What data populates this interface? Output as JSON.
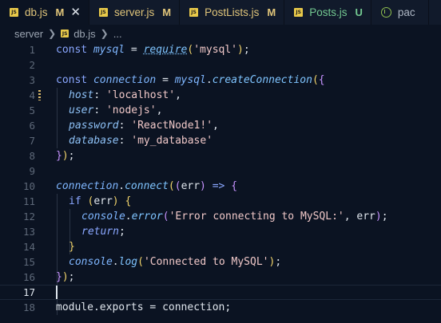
{
  "tabs": [
    {
      "label": "db.js",
      "badge": "M",
      "active": true,
      "icon": "js-icon"
    },
    {
      "label": "server.js",
      "badge": "M",
      "active": false,
      "icon": "js-icon"
    },
    {
      "label": "PostLists.js",
      "badge": "M",
      "active": false,
      "icon": "js-icon"
    },
    {
      "label": "Posts.js",
      "badge": "U",
      "active": false,
      "icon": "js-icon"
    },
    {
      "label": "pac",
      "badge": "",
      "active": false,
      "icon": "package-icon"
    }
  ],
  "breadcrumb": {
    "folder": "server",
    "file": "db.js",
    "more": "..."
  },
  "editor": {
    "current_line": 17,
    "line_numbers": [
      "1",
      "2",
      "3",
      "4",
      "5",
      "6",
      "7",
      "8",
      "9",
      "10",
      "11",
      "12",
      "13",
      "14",
      "15",
      "16",
      "17",
      "18"
    ],
    "lines": {
      "l1": {
        "kw": "const",
        "sp1": " ",
        "var": "mysql",
        "eq": " = ",
        "req": "require",
        "p1": "(",
        "str": "'mysql'",
        "p2": ")",
        "end": ";"
      },
      "l3": {
        "kw": "const",
        "sp1": " ",
        "var": "connection",
        "eq": " = ",
        "obj": "mysql",
        "dot": ".",
        "fn": "createConnection",
        "p1": "(",
        "br": "{"
      },
      "l4": {
        "prop": "host",
        "colon": ": ",
        "str": "'localhost'",
        "comma": ","
      },
      "l5": {
        "prop": "user",
        "colon": ": ",
        "str": "'nodejs'",
        "comma": ","
      },
      "l6": {
        "prop": "password",
        "colon": ": ",
        "str": "'ReactNode1!'",
        "comma": ","
      },
      "l7": {
        "prop": "database",
        "colon": ": ",
        "str": "'my_database'"
      },
      "l8": {
        "br": "}",
        "p2": ")",
        "end": ";"
      },
      "l10": {
        "obj": "connection",
        "dot": ".",
        "fn": "connect",
        "p1": "(",
        "p2": "(",
        "arg": "err",
        "p3": ")",
        "arrow": " => ",
        "br": "{"
      },
      "l11": {
        "kw": "if",
        "sp": " ",
        "p1": "(",
        "arg": "err",
        "p2": ")",
        "sp2": " ",
        "br": "{"
      },
      "l12": {
        "obj": "console",
        "dot": ".",
        "fn": "error",
        "p1": "(",
        "str": "'Error connecting to MySQL:'",
        "comma": ", ",
        "arg": "err",
        "p2": ")",
        "end": ";"
      },
      "l13": {
        "kw": "return",
        "end": ";"
      },
      "l14": {
        "br": "}"
      },
      "l15": {
        "obj": "console",
        "dot": ".",
        "fn": "log",
        "p1": "(",
        "str": "'Connected to MySQL'",
        "p2": ")",
        "end": ";"
      },
      "l16": {
        "br": "}",
        "p2": ")",
        "end": ");"
      },
      "l18": {
        "obj": "module",
        "dot": ".",
        "prop": "exports",
        "eq": " = ",
        "val": "connection",
        "end": ";"
      }
    }
  },
  "colors": {
    "background": "#0b1322",
    "tabbar": "#111a2b",
    "js_icon": "#e8c94a",
    "modified": "#e0c57a",
    "untracked": "#73c991"
  }
}
